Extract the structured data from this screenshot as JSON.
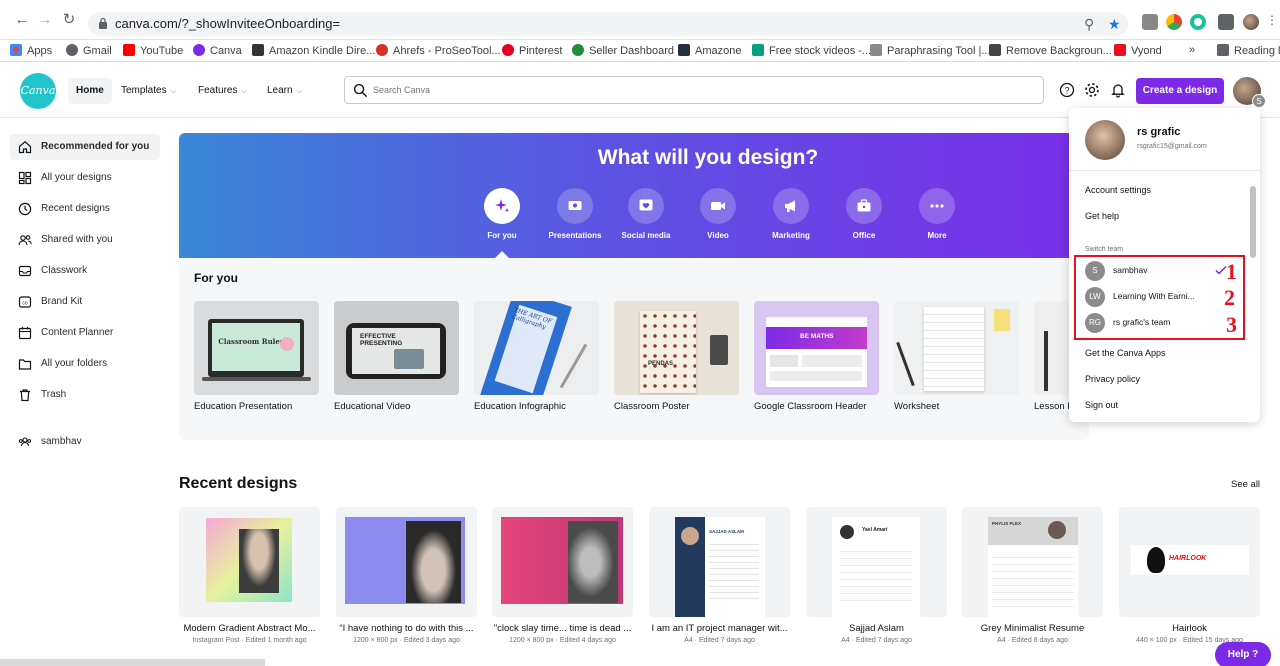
{
  "browser": {
    "url": "canva.com/?_showInviteeOnboarding=",
    "bookmarks": [
      {
        "label": "Apps",
        "color": "#ea4335"
      },
      {
        "label": "Gmail",
        "color": "#5f6368"
      },
      {
        "label": "YouTube",
        "color": "#ff0000"
      },
      {
        "label": "Canva",
        "color": "#7d2ae8"
      },
      {
        "label": "Amazon Kindle Dire...",
        "color": "#333333"
      },
      {
        "label": "Ahrefs - ProSeoTool...",
        "color": "#d93025"
      },
      {
        "label": "Pinterest",
        "color": "#e60023"
      },
      {
        "label": "Seller Dashboard",
        "color": "#1e8e3e"
      },
      {
        "label": "Amazone",
        "color": "#232f3e"
      },
      {
        "label": "Free stock videos -...",
        "color": "#05a081"
      },
      {
        "label": "Paraphrasing Tool |...",
        "color": "#555555"
      },
      {
        "label": "Remove Backgroun...",
        "color": "#444444"
      },
      {
        "label": "Vyond",
        "color": "#e8101c"
      },
      {
        "label": "»",
        "color": ""
      },
      {
        "label": "Reading lis",
        "color": "#5f6368"
      }
    ]
  },
  "header": {
    "logo": "Canva",
    "nav": [
      "Home",
      "Templates",
      "Features",
      "Learn"
    ],
    "search_placeholder": "Search Canva",
    "create_button": "Create a design",
    "avatar_badge": "S"
  },
  "sidebar": {
    "items": [
      {
        "label": "Recommended for you",
        "icon": "home-icon"
      },
      {
        "label": "All your designs",
        "icon": "grid-icon"
      },
      {
        "label": "Recent designs",
        "icon": "clock-icon"
      },
      {
        "label": "Shared with you",
        "icon": "people-icon"
      },
      {
        "label": "Classwork",
        "icon": "inbox-icon"
      },
      {
        "label": "Brand Kit",
        "icon": "brand-icon"
      },
      {
        "label": "Content Planner",
        "icon": "calendar-icon"
      },
      {
        "label": "All your folders",
        "icon": "folder-icon"
      },
      {
        "label": "Trash",
        "icon": "trash-icon"
      }
    ],
    "team": "sambhav"
  },
  "hero": {
    "title": "What will you design?",
    "categories": [
      "For you",
      "Presentations",
      "Social media",
      "Video",
      "Marketing",
      "Office",
      "More"
    ]
  },
  "for_you": {
    "title": "For you",
    "templates": [
      "Education Presentation",
      "Educational Video",
      "Education Infographic",
      "Classroom Poster",
      "Google Classroom Header",
      "Worksheet",
      "Lesson P"
    ],
    "thumb_texts": {
      "classroom_rules": "Classroom Rules",
      "effective_presenting": "EFFECTIVE PRESENTING",
      "calligraphy": "THE ART OF Calligraphy",
      "pendas": "PENDAS",
      "be_maths": "BE MATHS"
    }
  },
  "recent": {
    "title": "Recent designs",
    "see_all": "See all",
    "designs": [
      {
        "title": "Modern Gradient Abstract Mo...",
        "meta": "Instagram Post · Edited 1 month ago"
      },
      {
        "title": "“I have nothing to do with this ...",
        "meta": "1200 × 800 px · Edited 3 days ago"
      },
      {
        "title": "\"clock slay time... time is dead ...",
        "meta": "1200 × 800 px · Edited 4 days ago"
      },
      {
        "title": "I am an IT project manager wit...",
        "meta": "A4 · Edited 7 days ago"
      },
      {
        "title": "Sajjad Aslam",
        "meta": "A4 · Edited 7 days ago"
      },
      {
        "title": "Grey Minimalist Resume",
        "meta": "A4 · Edited 8 days ago"
      },
      {
        "title": "Hairlook",
        "meta": "440 × 100 px · Edited 15 days ago"
      }
    ],
    "thumb_texts": {
      "sajjad_heading": "SAJJAD ASLAM",
      "yael": "Yael Amari",
      "phylis": "PHYLIS FLEX",
      "hairlook": "HAIRLOOK"
    }
  },
  "account_menu": {
    "name": "rs grafic",
    "email": "rsgrafic15@gmail.com",
    "links_top": [
      "Account settings",
      "Get help"
    ],
    "switch_team_label": "Switch team",
    "teams": [
      {
        "initials": "S",
        "name": "sambhav",
        "selected": true
      },
      {
        "initials": "LW",
        "name": "Learning With Earni...",
        "selected": false
      },
      {
        "initials": "RG",
        "name": "rs grafic's team",
        "selected": false
      }
    ],
    "links_bottom": [
      "Get the Canva Apps",
      "Privacy policy",
      "Sign out"
    ],
    "annotations": [
      "1",
      "2",
      "3"
    ]
  },
  "help_button": "Help ?",
  "colors": {
    "accent": "#7d2ae8",
    "logo": "#20c4cb",
    "annotation": "#e8101c"
  }
}
